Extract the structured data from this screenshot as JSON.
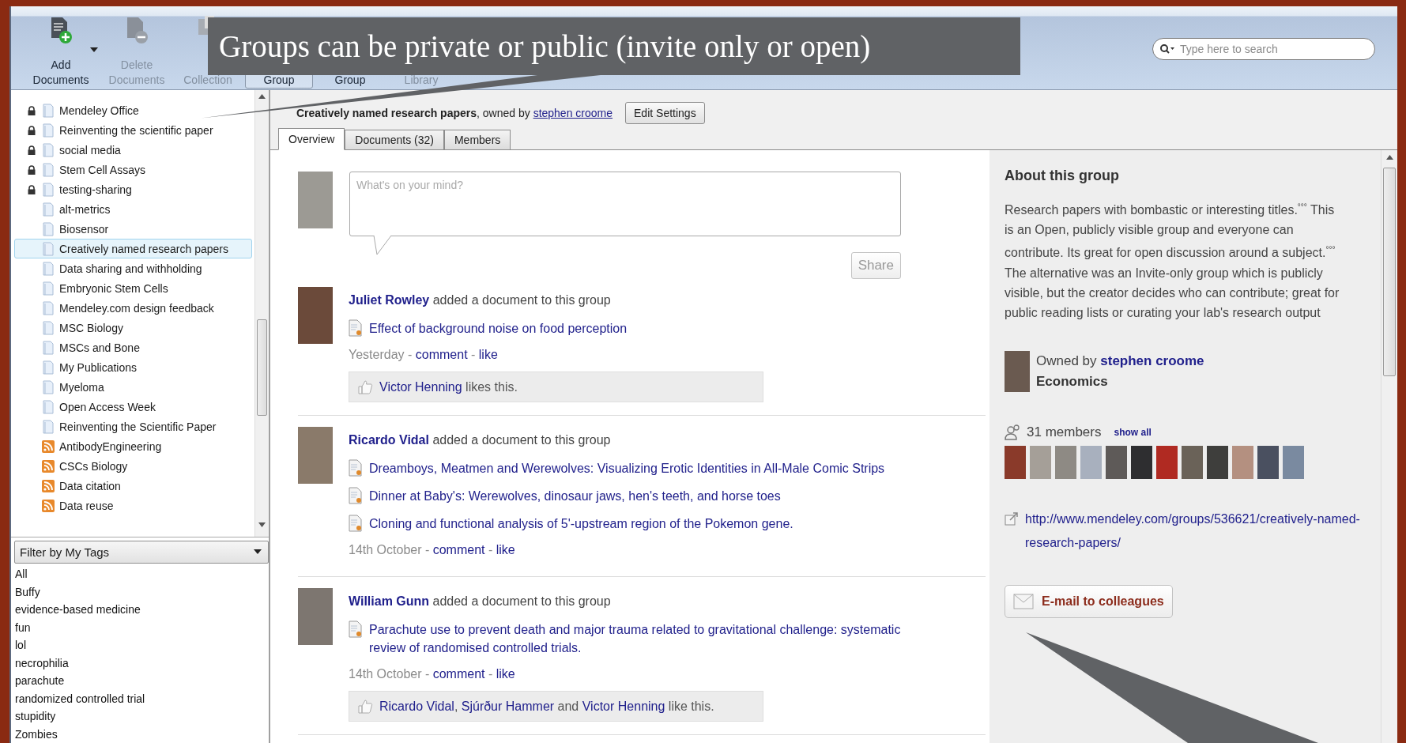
{
  "toolbar": {
    "buttons": [
      {
        "kind": "add",
        "label_lines": [
          "Add",
          "Documents"
        ],
        "disabled": false,
        "selected": false
      },
      {
        "kind": "delete",
        "label_lines": [
          "Delete",
          "Documents"
        ],
        "disabled": true,
        "selected": false
      },
      {
        "kind": "remove-from",
        "label_lines": [
          "Collection"
        ],
        "disabled": true,
        "selected": false
      },
      {
        "kind": "create-group",
        "label_lines": [
          "Group"
        ],
        "disabled": false,
        "selected": true
      },
      {
        "kind": "remove-group",
        "label_lines": [
          "Group"
        ],
        "disabled": false,
        "selected": false
      },
      {
        "kind": "sync",
        "label_lines": [
          "Library"
        ],
        "disabled": true,
        "selected": false
      }
    ],
    "search": {
      "placeholder": "Type here to search"
    }
  },
  "callouts": [
    {
      "text": "Groups can be private or public (invite only or open)"
    }
  ],
  "sidebar": {
    "groups": [
      {
        "kind": "group",
        "label": "Mendeley Office",
        "locked": true,
        "selected": false
      },
      {
        "kind": "group",
        "label": "Reinventing the scientific paper",
        "locked": true,
        "selected": false
      },
      {
        "kind": "group",
        "label": "social media",
        "locked": true,
        "selected": false
      },
      {
        "kind": "group",
        "label": "Stem Cell Assays",
        "locked": true,
        "selected": false
      },
      {
        "kind": "group",
        "label": "testing-sharing",
        "locked": true,
        "selected": false
      },
      {
        "kind": "group",
        "label": "alt-metrics",
        "locked": false,
        "selected": false
      },
      {
        "kind": "group",
        "label": "Biosensor",
        "locked": false,
        "selected": false
      },
      {
        "kind": "group",
        "label": "Creatively named research papers",
        "locked": false,
        "selected": true
      },
      {
        "kind": "group",
        "label": "Data sharing and withholding",
        "locked": false,
        "selected": false
      },
      {
        "kind": "group",
        "label": "Embryonic Stem Cells",
        "locked": false,
        "selected": false
      },
      {
        "kind": "group",
        "label": "Mendeley.com design feedback",
        "locked": false,
        "selected": false
      },
      {
        "kind": "group",
        "label": "MSC Biology",
        "locked": false,
        "selected": false
      },
      {
        "kind": "group",
        "label": "MSCs and Bone",
        "locked": false,
        "selected": false
      },
      {
        "kind": "group",
        "label": "My Publications",
        "locked": false,
        "selected": false
      },
      {
        "kind": "group",
        "label": "Myeloma",
        "locked": false,
        "selected": false
      },
      {
        "kind": "group",
        "label": "Open Access Week",
        "locked": false,
        "selected": false
      },
      {
        "kind": "group",
        "label": "Reinventing the Scientific Paper",
        "locked": false,
        "selected": false
      },
      {
        "kind": "feed",
        "label": "AntibodyEngineering",
        "locked": false,
        "selected": false
      },
      {
        "kind": "feed",
        "label": "CSCs Biology",
        "locked": false,
        "selected": false
      },
      {
        "kind": "feed",
        "label": "Data citation",
        "locked": false,
        "selected": false
      },
      {
        "kind": "feed",
        "label": "Data reuse",
        "locked": false,
        "selected": false
      }
    ],
    "tag_filter": {
      "label": "Filter by My Tags"
    },
    "tags": [
      "All",
      "Buffy",
      "evidence-based medicine",
      "fun",
      "lol",
      "necrophilia",
      "parachute",
      "randomized controlled trial",
      "stupidity",
      "Zombies"
    ]
  },
  "group_header": {
    "title": "Creatively named research papers",
    "owned_by": ", owned by ",
    "owner": "stephen croome",
    "button": "Edit Settings"
  },
  "tabs": [
    {
      "label": "Overview",
      "selected": true
    },
    {
      "label": "Documents (32)",
      "selected": false
    },
    {
      "label": "Members",
      "selected": false
    }
  ],
  "composer": {
    "placeholder": "What's on your mind?",
    "button": "Share"
  },
  "feed": [
    {
      "author": "Juliet Rowley",
      "action": " added a document to this group",
      "documents": [
        "Effect of background noise on food perception"
      ],
      "meta": {
        "date": "Yesterday",
        "actions": [
          {
            "separator": " - ",
            "label": "comment"
          },
          {
            "separator": " - ",
            "label": "like"
          }
        ]
      },
      "likes": {
        "people": [
          {
            "name": "Victor Henning"
          }
        ],
        "verb": " likes this."
      }
    },
    {
      "author": "Ricardo Vidal",
      "action": " added a document to this group",
      "documents": [
        "Dreamboys, Meatmen and Werewolves: Visualizing Erotic Identities in All-Male Comic Strips",
        "Dinner at Baby's: Werewolves, dinosaur jaws, hen's teeth, and horse toes",
        "Cloning and functional analysis of 5'-upstream region of the Pokemon gene."
      ],
      "meta": {
        "date": "14th October",
        "actions": [
          {
            "separator": " - ",
            "label": "comment"
          },
          {
            "separator": " - ",
            "label": "like"
          }
        ]
      }
    },
    {
      "author": "William Gunn",
      "action": " added a document to this group",
      "documents": [
        "Parachute use to prevent death and major trauma related to gravitational challenge: systematic review of randomised controlled trials."
      ],
      "meta": {
        "date": "14th October",
        "actions": [
          {
            "separator": " - ",
            "label": "comment"
          },
          {
            "separator": " - ",
            "label": "like"
          }
        ]
      },
      "likes": {
        "people": [
          {
            "name": "Ricardo Vidal",
            "separator": ", "
          },
          {
            "name": "Sjúrður Hammer",
            "separator": " and "
          },
          {
            "name": "Victor Henning"
          }
        ],
        "verb": " like this."
      }
    }
  ],
  "about": {
    "heading": "About this group",
    "description": "Research papers with bombastic or interesting titles.$^{°°°}$ This is an Open, publicly visible group and everyone can contribute. Its great for open discussion around a subject.$^{°°°}$ The alternative was an Invite-only group which is publicly visible, but the creator decides who can contribute; great for public reading lists or curating your lab's research output",
    "owner_prefix": "Owned by ",
    "owner": "stephen croome",
    "owner_field": "Economics",
    "members_count": "31 members",
    "show_all": "show all",
    "url": "http://www.mendeley.com/groups/536621/creatively-named-research-papers/",
    "email_button": "E-mail to colleagues"
  }
}
